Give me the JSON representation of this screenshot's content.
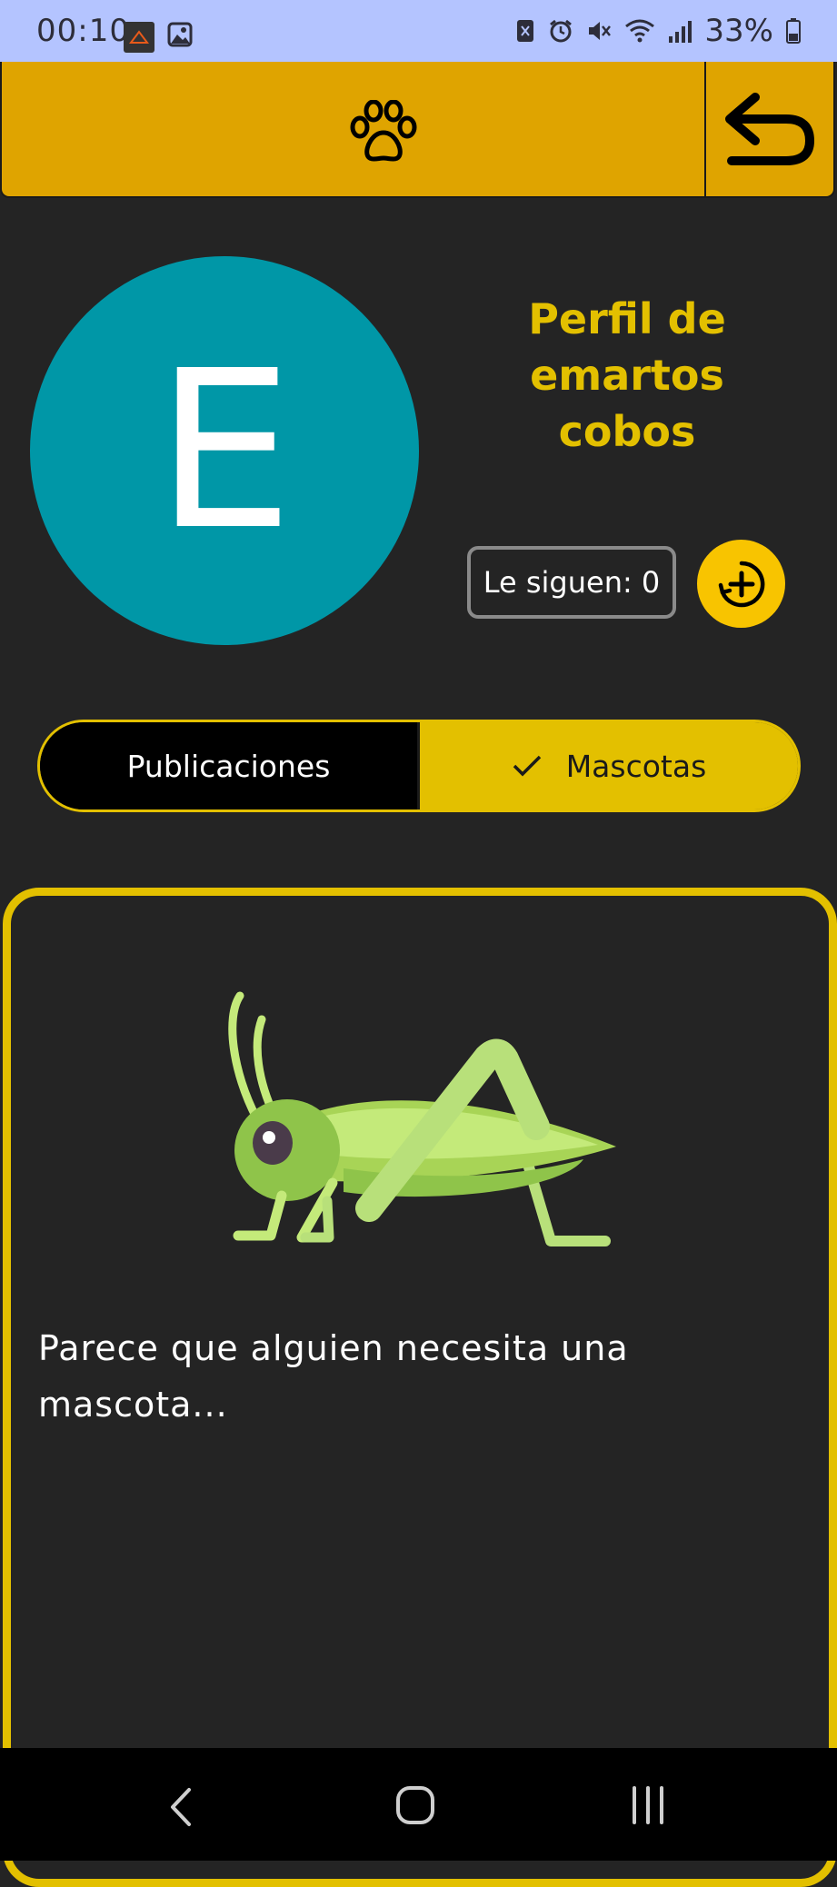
{
  "status_bar": {
    "time": "00:10",
    "battery": "33%",
    "icons": [
      "app-notification-icon",
      "image-notification-icon",
      "nfc-icon",
      "alarm-icon",
      "mute-icon",
      "wifi-icon",
      "signal-icon",
      "battery-icon"
    ]
  },
  "header": {
    "center_icon": "paw-icon",
    "back_icon": "undo-arrow-icon",
    "color": "#dfa400"
  },
  "profile": {
    "avatar_letter": "E",
    "avatar_color": "#0097a7",
    "title": "Perfil de emartos cobos",
    "followers_label": "Le siguen: 0",
    "follow_icon": "add-circle-icon"
  },
  "tabs": {
    "items": [
      {
        "label": "Publicaciones",
        "selected": false
      },
      {
        "label": "Mascotas",
        "selected": true
      }
    ],
    "accent": "#e3c000"
  },
  "pets": {
    "empty_message": "Parece que alguien necesita una mascota...",
    "illustration": "grasshopper-illustration"
  },
  "nav_bar": {
    "icons": [
      "nav-back-icon",
      "nav-home-icon",
      "nav-recents-icon"
    ]
  }
}
